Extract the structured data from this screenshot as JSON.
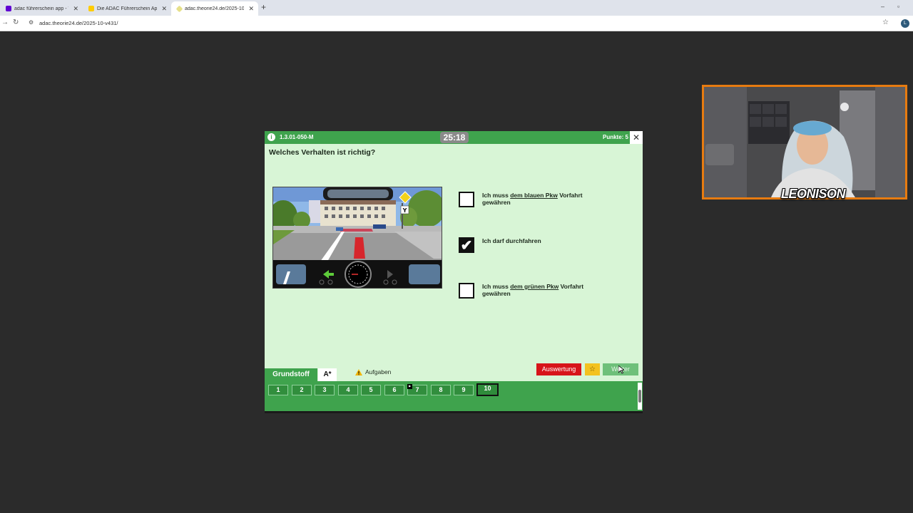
{
  "browser": {
    "tabs": [
      {
        "title": "adac führerschein app - Yahoo",
        "favicon_color": "#6001d2"
      },
      {
        "title": "Die ADAC Führerschein App",
        "favicon_color": "#ffcc00"
      },
      {
        "title": "adac.theorie24.de/2025-10-v431/",
        "favicon_color": "#e6e08a"
      }
    ],
    "url": "adac.theorie24.de/2025-10-v431/"
  },
  "quiz": {
    "question_code": "1.3.01-050-M",
    "timer": "25:18",
    "points": "Punkte: 5",
    "question": "Welches Verhalten ist richtig?",
    "answers": [
      {
        "pre": "Ich muss ",
        "link": "dem blauen Pkw",
        "post": " Vorfahrt gewähren",
        "checked": false
      },
      {
        "pre": "Ich darf durchfahren",
        "link": "",
        "post": "",
        "checked": true
      },
      {
        "pre": "Ich muss ",
        "link": "dem grünen Pkw",
        "post": " Vorfahrt gewähren",
        "checked": false
      }
    ],
    "buttons": {
      "evaluate": "Auswertung",
      "star": "☆",
      "next": "Weiter"
    },
    "tabs": {
      "basic": "Grundstoff",
      "class": "A*",
      "tasks": "Aufgaben"
    },
    "question_numbers": [
      "1",
      "2",
      "3",
      "4",
      "5",
      "6",
      "7",
      "8",
      "9",
      "10"
    ],
    "current_question": "10",
    "flagged_question": "7"
  },
  "webcam": {
    "streamer_name": "LEONISON"
  },
  "colors": {
    "header_green": "#3fa34d",
    "background_green": "#d8f5d6",
    "evaluate_red": "#d7141a",
    "star_yellow": "#f3c21f",
    "webcam_border": "#e77b10"
  }
}
